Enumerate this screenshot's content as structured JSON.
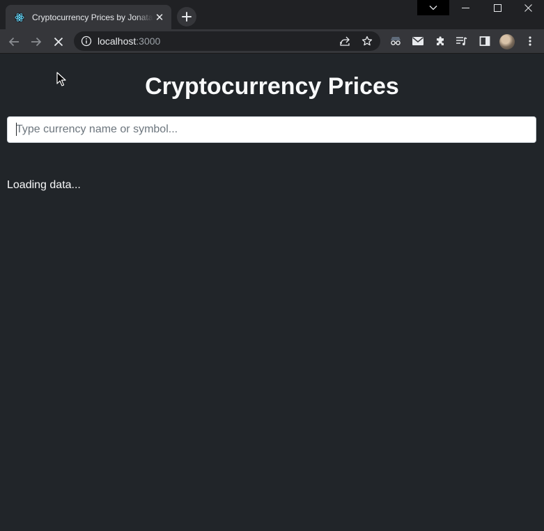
{
  "browser": {
    "tab": {
      "title": "Cryptocurrency Prices by Jonatan",
      "favicon": "react-logo-icon",
      "close_label": "✕"
    },
    "new_tab_icon": "plus-icon",
    "window_controls": [
      "chevron-down-icon",
      "minimize-icon",
      "maximize-icon",
      "close-icon"
    ],
    "address": {
      "host": "localhost",
      "port": ":3000"
    },
    "toolbar_icons": [
      "share-icon",
      "star-icon",
      "incognito-extension-icon",
      "mail-icon",
      "extensions-icon",
      "reading-list-icon",
      "side-panel-icon",
      "profile-avatar",
      "more-menu-icon"
    ]
  },
  "page": {
    "title": "Cryptocurrency Prices",
    "search": {
      "placeholder": "Type currency name or symbol...",
      "value": ""
    },
    "status": "Loading data..."
  },
  "colors": {
    "page_background": "#212529",
    "heading_text": "#f8f9fa",
    "chrome_frame": "#202124",
    "chrome_toolbar": "#35363a"
  }
}
